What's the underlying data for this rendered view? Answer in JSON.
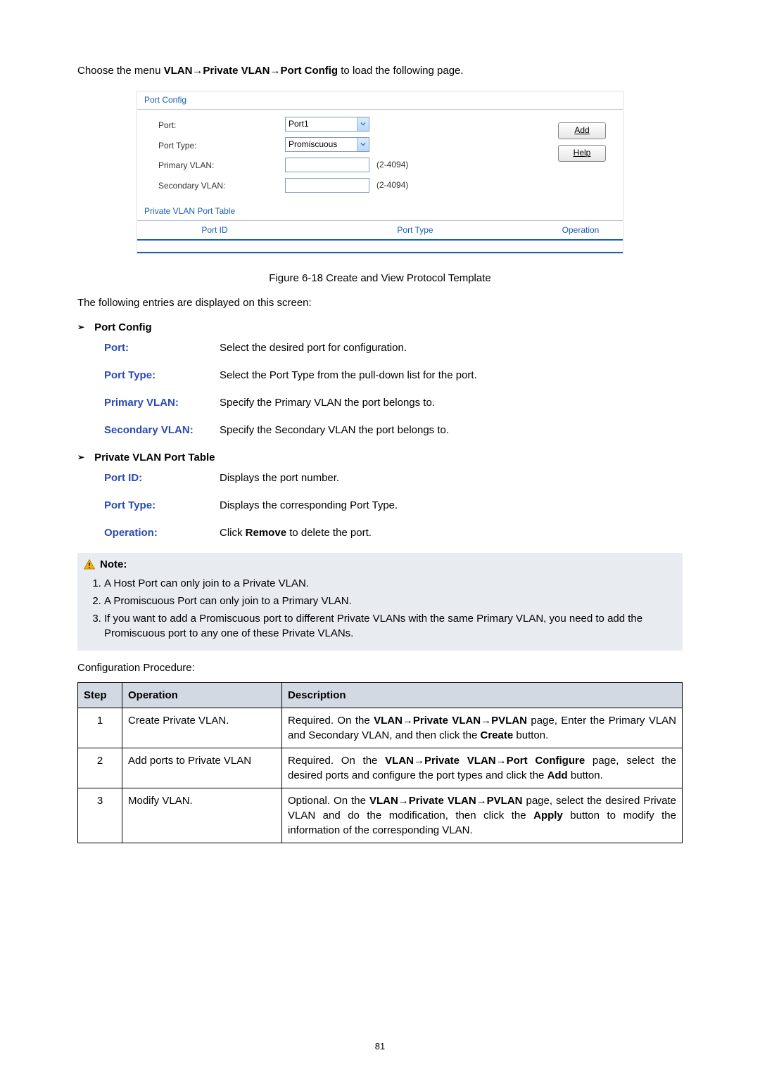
{
  "instruction": {
    "prefix": "Choose the menu ",
    "path": "VLAN→Private VLAN→Port Config",
    "suffix": " to load the following page."
  },
  "shot": {
    "port_config_title": "Port Config",
    "labels": {
      "port": "Port:",
      "port_type": "Port Type:",
      "primary_vlan": "Primary VLAN:",
      "secondary_vlan": "Secondary VLAN:"
    },
    "port_value": "Port1",
    "port_type_value": "Promiscuous",
    "range_hint": "(2-4094)",
    "add_label": "Add",
    "help_label": "Help",
    "table_title": "Private VLAN Port Table",
    "col_port_id": "Port ID",
    "col_port_type": "Port Type",
    "col_operation": "Operation"
  },
  "figure_caption": "Figure 6-18 Create and View Protocol Template",
  "entries_line": "The following entries are displayed on this screen:",
  "port_config_heading": "Port Config",
  "defs1": {
    "port_l": "Port:",
    "port_v": "Select the desired port for configuration.",
    "ptype_l": "Port Type:",
    "ptype_v": "Select the Port Type from the pull-down list for the port.",
    "pvlan_l": "Primary VLAN:",
    "pvlan_v": "Specify the Primary VLAN the port belongs to.",
    "svlan_l": "Secondary VLAN:",
    "svlan_v": "Specify the Secondary VLAN the port belongs to."
  },
  "pvpt_heading": "Private VLAN Port Table",
  "defs2": {
    "pid_l": "Port ID:",
    "pid_v": "Displays the port number.",
    "ptype_l": "Port Type:",
    "ptype_v": "Displays the corresponding Port Type.",
    "op_l": "Operation:",
    "op_v_pre": "Click ",
    "op_v_bold": "Remove",
    "op_v_post": " to delete the port."
  },
  "note": {
    "title": "Note:",
    "items": [
      "A Host Port can only join to a Private VLAN.",
      "A Promiscuous Port can only join to a Primary VLAN.",
      "If you want to add a Promiscuous port to different Private VLANs with the same Primary VLAN, you need to add the Promiscuous port to any one of these Private VLANs."
    ]
  },
  "config_proc": "Configuration Procedure:",
  "table": {
    "h_step": "Step",
    "h_op": "Operation",
    "h_desc": "Description",
    "rows": [
      {
        "step": "1",
        "op": "Create Private VLAN.",
        "desc_pre": "Required. On the ",
        "desc_bold": "VLAN→Private VLAN→PVLAN",
        "desc_mid": " page, Enter the Primary VLAN and Secondary VLAN, and then click the ",
        "desc_bold2": "Create",
        "desc_post": " button."
      },
      {
        "step": "2",
        "op": "Add ports to Private VLAN",
        "desc_pre": "Required. On the ",
        "desc_bold": "VLAN→Private VLAN→Port Configure",
        "desc_mid": " page, select the desired ports and configure the port types and click the ",
        "desc_bold2": "Add",
        "desc_post": " button."
      },
      {
        "step": "3",
        "op": "Modify VLAN.",
        "desc_pre": "Optional. On the ",
        "desc_bold": "VLAN→Private VLAN→PVLAN",
        "desc_mid": " page, select the desired Private VLAN and do the modification, then click the ",
        "desc_bold2": "Apply",
        "desc_post": " button to modify the information of the corresponding VLAN."
      }
    ]
  },
  "page_number": "81"
}
